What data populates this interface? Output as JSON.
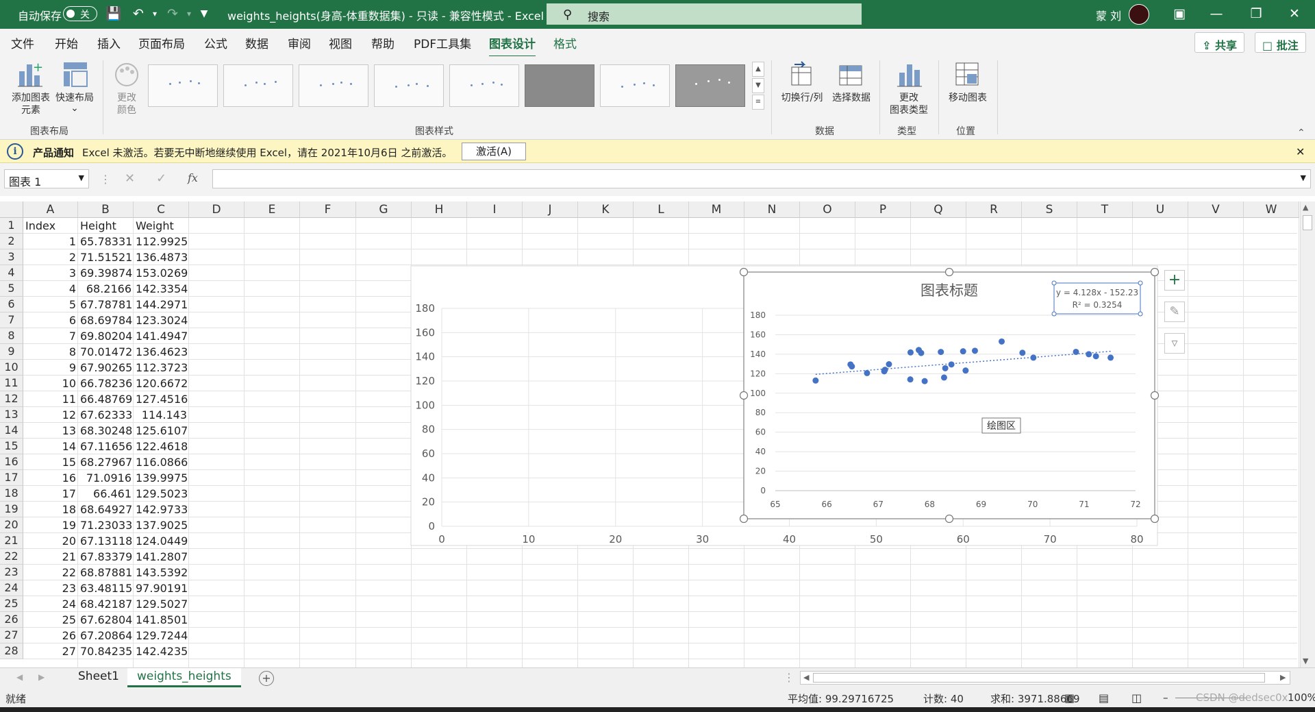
{
  "titlebar": {
    "autosave_label": "自动保存",
    "autosave_state": "关",
    "doc_title": "weights_heights(身高-体重数据集) - 只读 - 兼容性模式 - Excel",
    "search_placeholder": "搜索",
    "user_name": "蒙 刘"
  },
  "menu": {
    "tabs": [
      "文件",
      "开始",
      "插入",
      "页面布局",
      "公式",
      "数据",
      "审阅",
      "视图",
      "帮助",
      "PDF工具集",
      "图表设计",
      "格式"
    ],
    "active_tab": "图表设计",
    "share_label": "共享",
    "comment_label": "批注"
  },
  "ribbon": {
    "add_element": "添加图表",
    "add_element2": "元素",
    "quick_layout": "快速布局",
    "change_color": "更改",
    "change_color2": "颜色",
    "group_layout": "图表布局",
    "group_styles": "图表样式",
    "switch_rowcol": "切换行/列",
    "select_data": "选择数据",
    "group_data": "数据",
    "change_type": "更改",
    "change_type2": "图表类型",
    "group_type": "类型",
    "move_chart": "移动图表",
    "group_location": "位置"
  },
  "notification": {
    "title": "产品通知",
    "message": "Excel 未激活。若要无中断地继续使用 Excel，请在 2021年10月6日 之前激活。",
    "button": "激活(A)"
  },
  "formula_bar": {
    "name_box": "图表 1",
    "fx": "fx",
    "value": ""
  },
  "columns": [
    "A",
    "B",
    "C",
    "D",
    "E",
    "F",
    "G",
    "H",
    "I",
    "J",
    "K",
    "L",
    "M",
    "N",
    "O",
    "P",
    "Q",
    "R",
    "S",
    "T",
    "U",
    "V",
    "W"
  ],
  "rows": [
    [
      "Index",
      "Height",
      "Weight"
    ],
    [
      "1",
      "65.78331",
      "112.9925"
    ],
    [
      "2",
      "71.51521",
      "136.4873"
    ],
    [
      "3",
      "69.39874",
      "153.0269"
    ],
    [
      "4",
      "68.2166",
      "142.3354"
    ],
    [
      "5",
      "67.78781",
      "144.2971"
    ],
    [
      "6",
      "68.69784",
      "123.3024"
    ],
    [
      "7",
      "69.80204",
      "141.4947"
    ],
    [
      "8",
      "70.01472",
      "136.4623"
    ],
    [
      "9",
      "67.90265",
      "112.3723"
    ],
    [
      "10",
      "66.78236",
      "120.6672"
    ],
    [
      "11",
      "66.48769",
      "127.4516"
    ],
    [
      "12",
      "67.62333",
      "114.143"
    ],
    [
      "13",
      "68.30248",
      "125.6107"
    ],
    [
      "14",
      "67.11656",
      "122.4618"
    ],
    [
      "15",
      "68.27967",
      "116.0866"
    ],
    [
      "16",
      "71.0916",
      "139.9975"
    ],
    [
      "17",
      "66.461",
      "129.5023"
    ],
    [
      "18",
      "68.64927",
      "142.9733"
    ],
    [
      "19",
      "71.23033",
      "137.9025"
    ],
    [
      "20",
      "67.13118",
      "124.0449"
    ],
    [
      "21",
      "67.83379",
      "141.2807"
    ],
    [
      "22",
      "68.87881",
      "143.5392"
    ],
    [
      "23",
      "63.48115",
      "97.90191"
    ],
    [
      "24",
      "68.42187",
      "129.5027"
    ],
    [
      "25",
      "67.62804",
      "141.8501"
    ],
    [
      "26",
      "67.20864",
      "129.7244"
    ],
    [
      "27",
      "70.84235",
      "142.4235"
    ]
  ],
  "sheet_tabs": [
    "Sheet1",
    "weights_heights"
  ],
  "active_sheet": "weights_heights",
  "status": {
    "ready": "就绪",
    "average": "平均值: 99.29716725",
    "count": "计数: 40",
    "sum": "求和: 3971.88669",
    "zoom": "100%",
    "watermark": "CSDN @dedsec0x"
  },
  "chart_data": [
    {
      "type": "scatter",
      "title": "",
      "ylim": [
        0,
        180
      ],
      "xlim": [
        0,
        80
      ],
      "y_ticks": [
        "0",
        "20",
        "40",
        "60",
        "80",
        "100",
        "120",
        "140",
        "160",
        "180"
      ],
      "x_ticks": [
        "0",
        "10",
        "20",
        "30",
        "40",
        "50",
        "60",
        "70",
        "80"
      ],
      "grid": true
    },
    {
      "type": "scatter",
      "title": "图表标题",
      "xlim": [
        65,
        72
      ],
      "ylim": [
        0,
        180
      ],
      "x_ticks": [
        "65",
        "66",
        "67",
        "68",
        "69",
        "70",
        "71",
        "72"
      ],
      "y_ticks": [
        "0",
        "20",
        "40",
        "60",
        "80",
        "100",
        "120",
        "140",
        "160",
        "180"
      ],
      "trendline": {
        "slope": 4.128,
        "intercept": -152.23,
        "label": "y = 4.128x - 152.23",
        "r2_label": "R² = 0.3254"
      },
      "plot_area_tooltip": "绘图区",
      "series": [
        {
          "x": [
            65.78331,
            71.51521,
            69.39874,
            68.2166,
            67.78781,
            68.69784,
            69.80204,
            70.01472,
            67.90265,
            66.78236,
            66.48769,
            67.62333,
            68.30248,
            67.11656,
            68.27967,
            71.0916,
            66.461,
            68.64927,
            71.23033,
            67.13118,
            67.83379,
            68.87881,
            68.42187,
            67.62804,
            67.20864,
            70.84235
          ],
          "y": [
            112.9925,
            136.4873,
            153.0269,
            142.3354,
            144.2971,
            123.3024,
            141.4947,
            136.4623,
            112.3723,
            120.6672,
            127.4516,
            114.143,
            125.6107,
            122.4618,
            116.0866,
            139.9975,
            129.5023,
            142.9733,
            137.9025,
            124.0449,
            141.2807,
            143.5392,
            129.5027,
            141.8501,
            129.7244,
            142.4235
          ],
          "color": "#4472c4"
        }
      ]
    }
  ],
  "colors": {
    "excel_green": "#217346",
    "marker": "#4472c4",
    "notify_bg": "#fdf5c2"
  }
}
